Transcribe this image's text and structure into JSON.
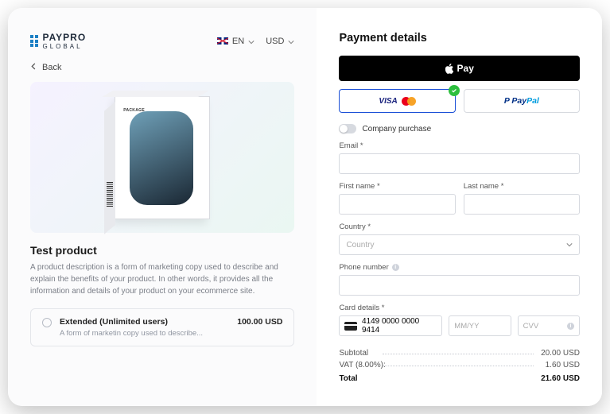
{
  "header": {
    "logo_main": "PAYPRO",
    "logo_sub": "GLOBAL",
    "lang": "EN",
    "currency": "USD",
    "back": "Back"
  },
  "product": {
    "box_label": "PACKAGE",
    "title": "Test product",
    "description": "A product description is a form of marketing copy used to describe and explain the benefits of your product. In other words, it provides all the information and details of your product on your ecommerce site."
  },
  "option": {
    "title": "Extended (Unlimited users)",
    "desc": "A form of marketin copy used to describe...",
    "price": "100.00 USD"
  },
  "payment": {
    "heading": "Payment details",
    "apple_pay": "Pay",
    "visa": "VISA",
    "paypal_p1": "Pay",
    "paypal_p2": "Pal",
    "company_toggle": "Company purchase",
    "email_label": "Email *",
    "first_name_label": "First name *",
    "last_name_label": "Last name *",
    "country_label": "Country *",
    "country_placeholder": "Country",
    "phone_label": "Phone number",
    "card_details_label": "Card details *",
    "card_number": "4149 0000 0000 9414",
    "card_exp": "MM/YY",
    "card_cvv": "CVV"
  },
  "totals": {
    "subtotal_label": "Subtotal",
    "subtotal_value": "20.00 USD",
    "vat_label": "VAT (8.00%):",
    "vat_value": "1.60 USD",
    "total_label": "Total",
    "total_value": "21.60 USD"
  }
}
